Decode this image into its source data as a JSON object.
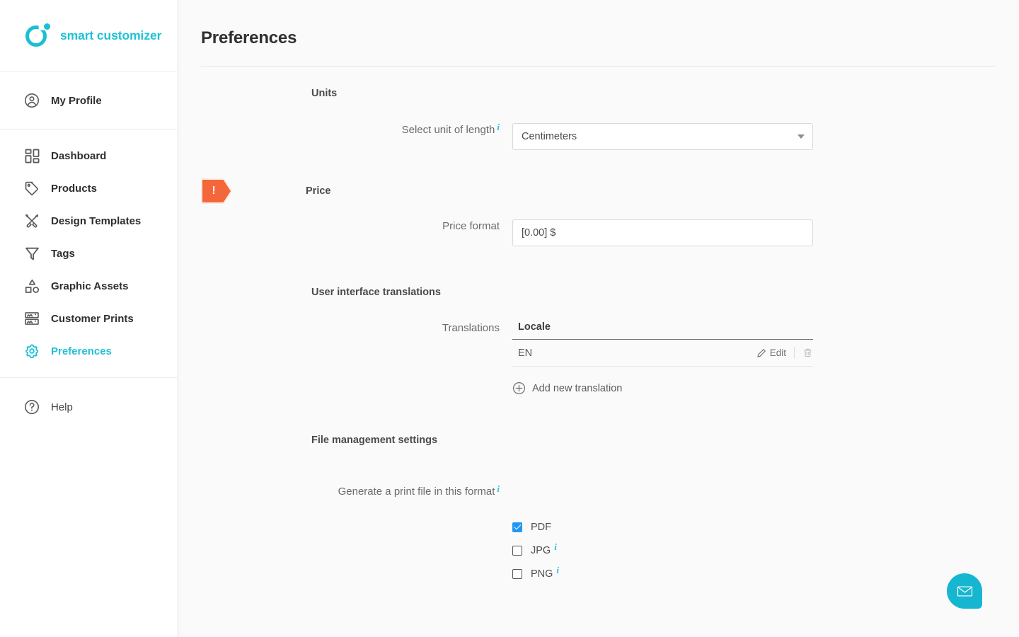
{
  "brand": {
    "name": "smart customizer",
    "logo_icon": "smart-customizer-logo",
    "accent_color": "#21c1d6"
  },
  "sidebar": {
    "profile": {
      "label": "My Profile",
      "icon": "user-circle-icon"
    },
    "items": [
      {
        "label": "Dashboard",
        "icon": "dashboard-grid-icon",
        "active": false
      },
      {
        "label": "Products",
        "icon": "tag-icon",
        "active": false
      },
      {
        "label": "Design Templates",
        "icon": "design-templates-icon",
        "active": false
      },
      {
        "label": "Tags",
        "icon": "filter-funnel-icon",
        "active": false
      },
      {
        "label": "Graphic Assets",
        "icon": "shapes-icon",
        "active": false
      },
      {
        "label": "Customer Prints",
        "icon": "prints-rows-icon",
        "active": false
      },
      {
        "label": "Preferences",
        "icon": "gear-icon",
        "active": true
      }
    ],
    "help": {
      "label": "Help",
      "icon": "question-circle-icon"
    }
  },
  "header": {
    "title": "Preferences"
  },
  "sections": {
    "units": {
      "title": "Units",
      "unit_field": {
        "label": "Select unit of length",
        "info_icon": "info-icon",
        "value": "Centimeters",
        "caret_icon": "chevron-down-icon"
      }
    },
    "price": {
      "title": "Price",
      "warning_icon": "warning-exclamation-badge",
      "warning_symbol": "!",
      "warning_color": "#f4673a",
      "format_field": {
        "label": "Price format",
        "value": "[0.00] $",
        "placeholder": ""
      }
    },
    "translations": {
      "title": "User interface translations",
      "field_label": "Translations",
      "table": {
        "columns": [
          "Locale"
        ],
        "rows": [
          {
            "locale": "EN",
            "edit_label": "Edit",
            "edit_icon": "pencil-icon",
            "delete_icon": "trash-icon"
          }
        ]
      },
      "add_link": {
        "label": "Add new translation",
        "icon": "plus-circle-icon"
      }
    },
    "file_management": {
      "title": "File management settings",
      "format_label": "Generate a print file in this format",
      "format_info_icon": "info-icon",
      "formats": [
        {
          "label": "PDF",
          "checked": true,
          "has_info": false
        },
        {
          "label": "JPG",
          "checked": false,
          "has_info": true
        },
        {
          "label": "PNG",
          "checked": false,
          "has_info": true
        }
      ],
      "checked_color": "#2196f3"
    }
  },
  "chat": {
    "icon": "envelope-icon",
    "color": "#17b6d0"
  }
}
